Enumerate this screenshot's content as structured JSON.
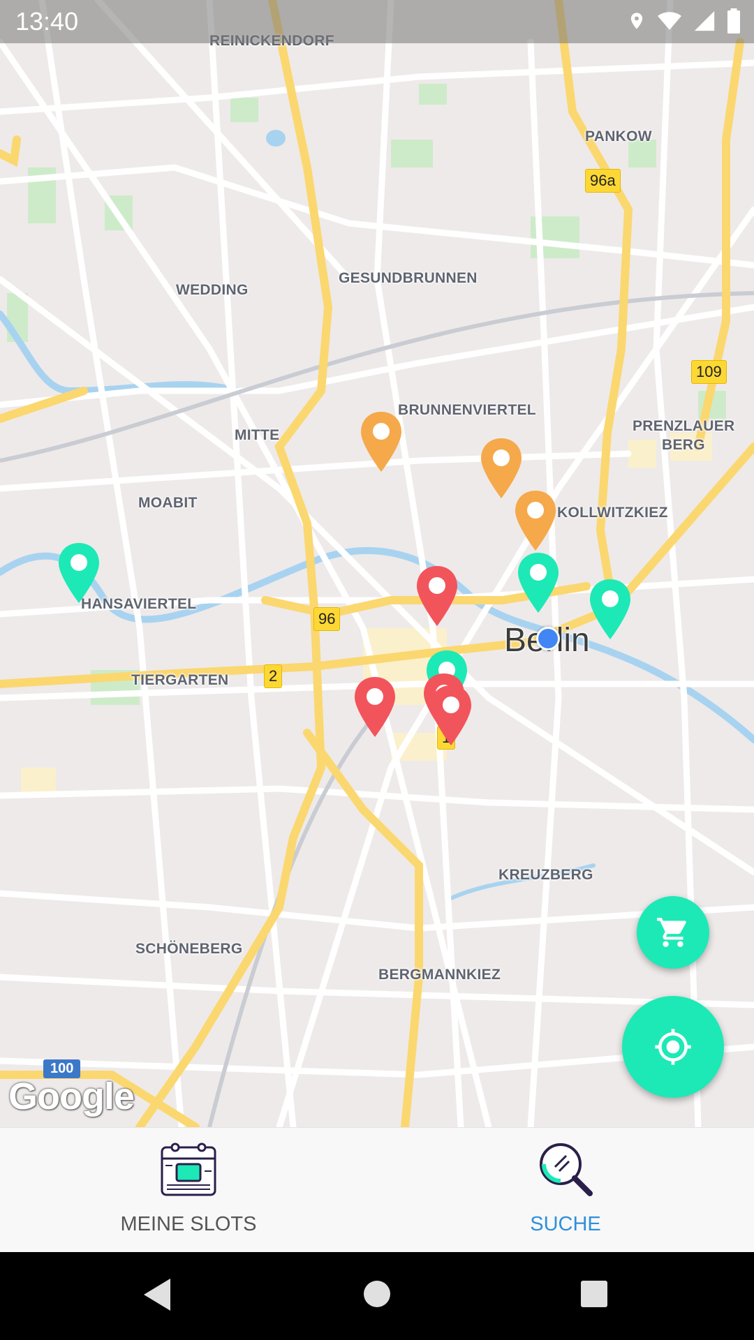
{
  "status_bar": {
    "time": "13:40"
  },
  "map": {
    "labels": {
      "reinickendorf": "REINICKENDORF",
      "pankow": "PANKOW",
      "wedding": "WEDDING",
      "gesundbrunnen": "GESUNDBRUNNEN",
      "brunnenviertel": "BRUNNENVIERTEL",
      "mitte": "MITTE",
      "prenzlauer_berg_1": "PRENZLAUER",
      "prenzlauer_berg_2": "BERG",
      "moabit": "MOABIT",
      "kollwitzkiez": "KOLLWITZKIEZ",
      "hansaviertel": "HANSAVIERTEL",
      "tiergarten": "TIERGARTEN",
      "berlin": "Berlin",
      "kreuzberg": "KREUZBERG",
      "schoeneberg": "SCHÖNEBERG",
      "bergmannkiez": "BERGMANNKIEZ"
    },
    "shields": {
      "r96a": "96a",
      "r109": "109",
      "r96": "96",
      "r2": "2",
      "r1": "1",
      "r100": "100"
    },
    "attribution": "Google",
    "pin_colors": {
      "green": "#1de9b6",
      "orange": "#f5a94a",
      "red": "#f2545b"
    }
  },
  "fab": {
    "cart_icon": "shopping-cart-icon",
    "locate_icon": "my-location-icon",
    "color": "#1de9b6"
  },
  "bottom_nav": {
    "items": [
      {
        "label": "MEINE SLOTS",
        "icon": "calendar-slots-icon",
        "active": false
      },
      {
        "label": "SUCHE",
        "icon": "search-magnifier-icon",
        "active": true
      }
    ],
    "active_color": "#2f8fdc",
    "inactive_color": "#555555"
  }
}
